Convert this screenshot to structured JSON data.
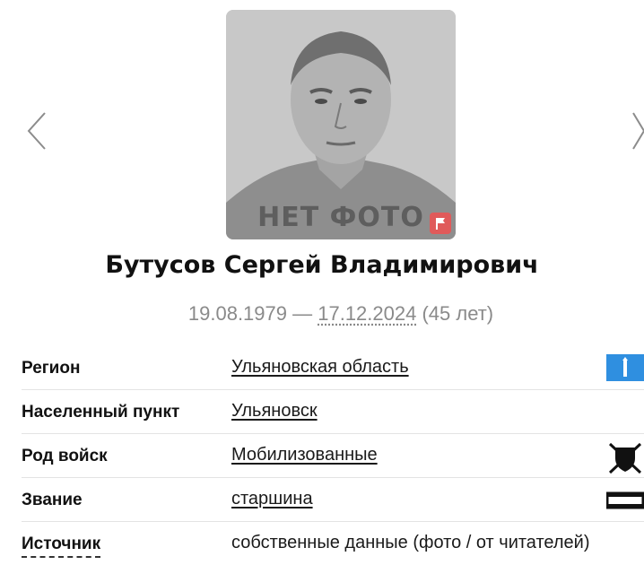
{
  "profile": {
    "photo_label": "НЕТ ФОТО",
    "name": "Бутусов Сергей Владимирович",
    "birth_date": "19.08.1979",
    "date_separator": " — ",
    "death_date": "17.12.2024",
    "age": " (45 лет)"
  },
  "details": [
    {
      "label": "Регион",
      "value": "Ульяновская область",
      "icon": "region-flag-icon"
    },
    {
      "label": "Населенный пункт",
      "value": "Ульяновск"
    },
    {
      "label": "Род войск",
      "value": "Мобилизованные",
      "icon": "shield-swords-icon"
    },
    {
      "label": "Звание",
      "value": "старшина",
      "icon": "rank-insignia-icon"
    },
    {
      "label": "Источник",
      "value": "собственные данные (фото / от читателей)"
    }
  ],
  "colors": {
    "accent_flag": "#e05a5a",
    "region_flag": "#2f8fe0",
    "muted_text": "#8a8a8a"
  }
}
